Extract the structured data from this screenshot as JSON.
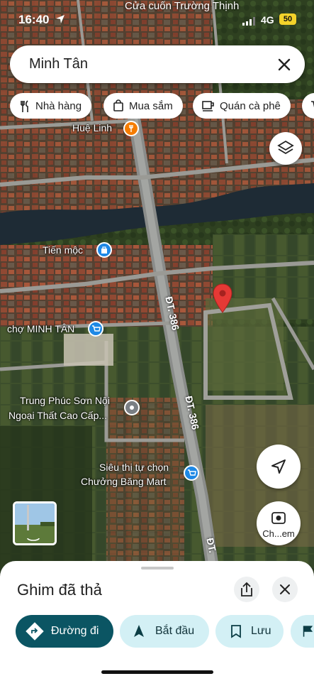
{
  "status": {
    "time": "16:40",
    "network": "4G",
    "battery": "50"
  },
  "top_poi": "Cửa cuốn Trường Thịnh",
  "search": {
    "query": "Minh Tân"
  },
  "chips": [
    {
      "label": "Nhà hàng",
      "icon": "restaurant-icon"
    },
    {
      "label": "Mua sắm",
      "icon": "shopping-bag-icon"
    },
    {
      "label": "Quán cà phê",
      "icon": "coffee-icon"
    }
  ],
  "map_labels": {
    "hue_linh": "Huệ Linh",
    "tien_moc": "Tiến mộc",
    "cho_minh_tan": "chợ MINH TÂN",
    "trung_phuc_1": "Trung Phúc Sơn Nội",
    "trung_phuc_2": "Ngoại Thất Cao Cấp...",
    "sieu_thi_1": "Siêu thị tự chọn",
    "sieu_thi_2": "Chưởng Băng Mart",
    "road_1": "ĐT. 386",
    "road_2": "ĐT. 386",
    "road_3": "ĐT."
  },
  "lens_label": "Ch...em",
  "sheet": {
    "title": "Ghim đã thả",
    "actions": [
      {
        "label": "Đường đi"
      },
      {
        "label": "Bắt đầu"
      },
      {
        "label": "Lưu"
      }
    ]
  },
  "colors": {
    "primary_action": "#0b5563",
    "secondary_action": "#d3f0f5",
    "pin": "#e53935",
    "poi_food": "#f57c00",
    "poi_shop": "#1e88e5"
  }
}
